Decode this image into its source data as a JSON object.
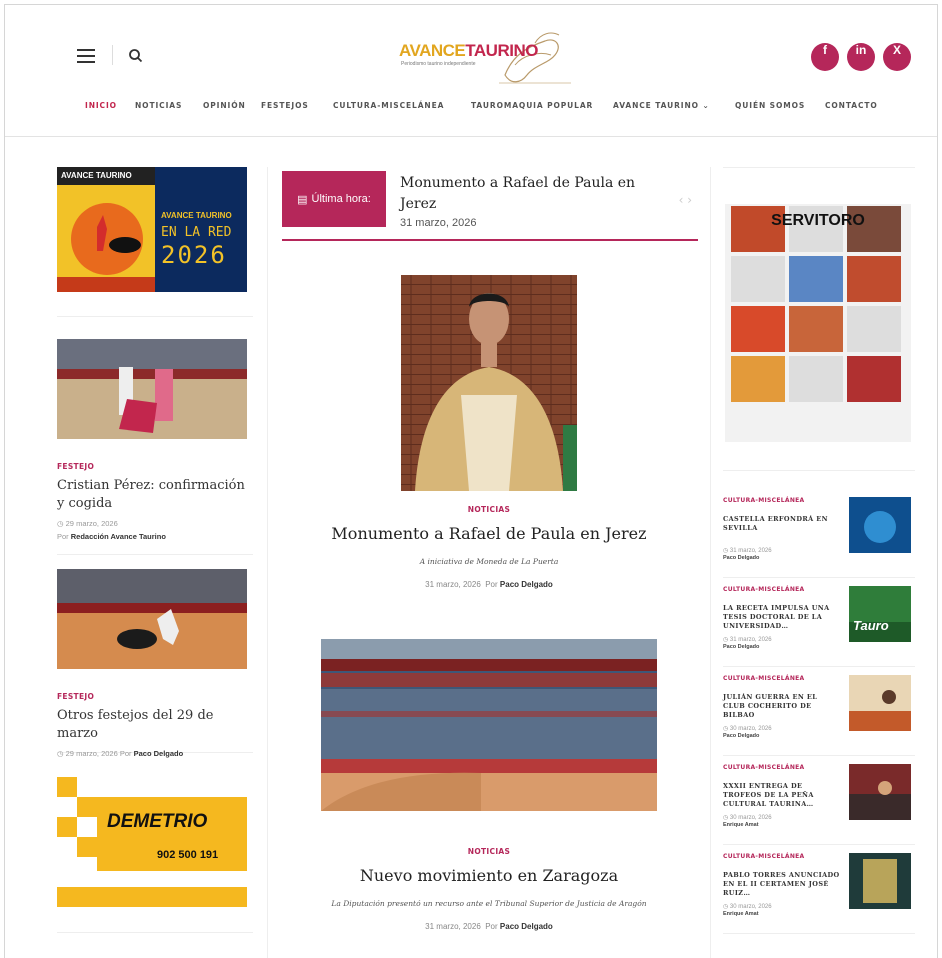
{
  "header": {
    "logo_main_1": "AVANCE",
    "logo_main_2": "TAURINO",
    "logo_sub": "Periodismo taurino independiente",
    "social": [
      "f",
      "in",
      "X"
    ]
  },
  "nav": [
    "INICIO",
    "NOTICIAS",
    "OPINIÓN",
    "FESTEJOS",
    "CULTURA-MISCELÁNEA",
    "TAUROMAQUIA POPULAR",
    "AVANCE TAURINO",
    "QUIÉN SOMOS",
    "CONTACTO"
  ],
  "left": {
    "banner_top": "AVANCE TAURINO",
    "banner_l1": "AVANCE TAURINO",
    "banner_l2": "EN LA RED",
    "banner_l3": "2026",
    "posts": [
      {
        "cat": "FESTEJO",
        "title": "Cristian Pérez: confirmación y cogida",
        "date": "29 marzo, 2026",
        "by": "Por",
        "author": "Redacción Avance Taurino"
      },
      {
        "cat": "FESTEJO",
        "title": "Otros festejos del 29 de marzo",
        "date": "29 marzo, 2026",
        "by": "Por",
        "author": "Paco Delgado"
      }
    ],
    "ad_name": "DEMETRIO",
    "ad_phone": "902 500 191"
  },
  "ticker": {
    "label": "Última hora:",
    "title": "Monumento a Rafael de Paula en Jerez",
    "date": "31 marzo, 2026"
  },
  "main": [
    {
      "cat": "NOTICIAS",
      "title": "Monumento a Rafael de Paula en Jerez",
      "excerpt": "A iniciativa de Moneda de La Puerta",
      "date": "31 marzo, 2026",
      "by": "Por",
      "author": "Paco Delgado"
    },
    {
      "cat": "NOTICIAS",
      "title": "Nuevo movimiento en Zaragoza",
      "excerpt": "La Diputación presentó un recurso ante el Tribunal Superior de Justicia de Aragón",
      "date": "31 marzo, 2026",
      "by": "Por",
      "author": "Paco Delgado"
    }
  ],
  "right": {
    "servitoro": "SERVITORO",
    "items": [
      {
        "cat": "CULTURA-MISCELÁNEA",
        "title": "CASTELLA ERFONDRÁ EN SEVILLA",
        "date": "31 marzo, 2026",
        "author": "Paco Delgado"
      },
      {
        "cat": "CULTURA-MISCELÁNEA",
        "title": "LA RECETA IMPULSA UNA TESIS DOCTORAL DE LA UNIVERSIDAD…",
        "date": "31 marzo, 2026",
        "author": "Paco Delgado"
      },
      {
        "cat": "CULTURA-MISCELÁNEA",
        "title": "JULIÁN GUERRA EN EL CLUB COCHERITO DE BILBAO",
        "date": "30 marzo, 2026",
        "author": "Paco Delgado"
      },
      {
        "cat": "CULTURA-MISCELÁNEA",
        "title": "XXXII ENTREGA DE TROFEOS DE LA PEÑA CULTURAL TAURINA…",
        "date": "30 marzo, 2026",
        "author": "Enrique Amat"
      },
      {
        "cat": "CULTURA-MISCELÁNEA",
        "title": "PABLO TORRES ANUNCIADO EN EL II CERTAMEN JOSÉ RUIZ…",
        "date": "30 marzo, 2026",
        "author": "Enrique Amat"
      }
    ],
    "thumb_text": "Tauro"
  },
  "colors": {
    "accent": "#b5275a",
    "logo_gold": "#e2a61f"
  }
}
